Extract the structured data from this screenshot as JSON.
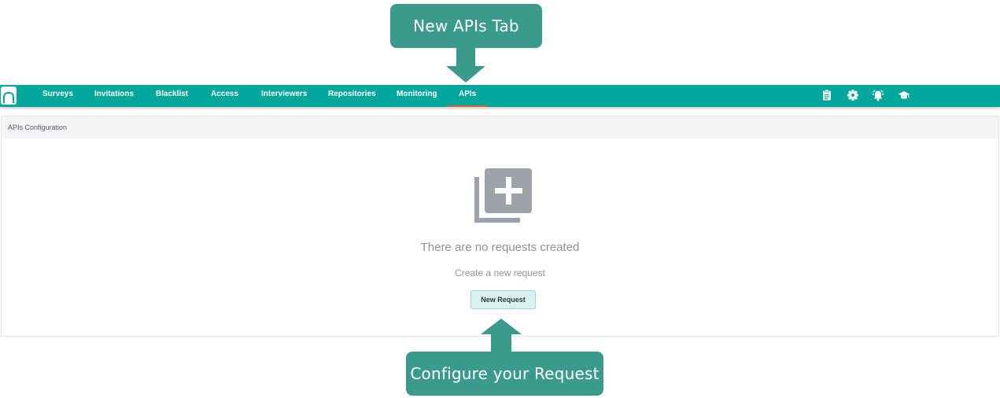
{
  "callouts": {
    "top": "New APIs Tab",
    "bottom": "Configure your Request"
  },
  "nav": {
    "items": [
      {
        "label": "Surveys"
      },
      {
        "label": "Invitations"
      },
      {
        "label": "Blacklist"
      },
      {
        "label": "Access"
      },
      {
        "label": "Interviewers"
      },
      {
        "label": "Repositories"
      },
      {
        "label": "Monitoring"
      },
      {
        "label": "APIs",
        "active": true
      }
    ],
    "icons": [
      "clipboard-icon",
      "gear-icon",
      "alarm-bell-icon",
      "graduation-cap-icon"
    ]
  },
  "panel": {
    "header": "APIs Configuration",
    "empty_title": "There are no requests created",
    "empty_subtitle": "Create a new request",
    "button_label": "New Request"
  },
  "colors": {
    "brand": "#00a79a",
    "callout": "#3a9a8c",
    "active_underline": "#e2613a",
    "empty_icon": "#9da2ab"
  }
}
